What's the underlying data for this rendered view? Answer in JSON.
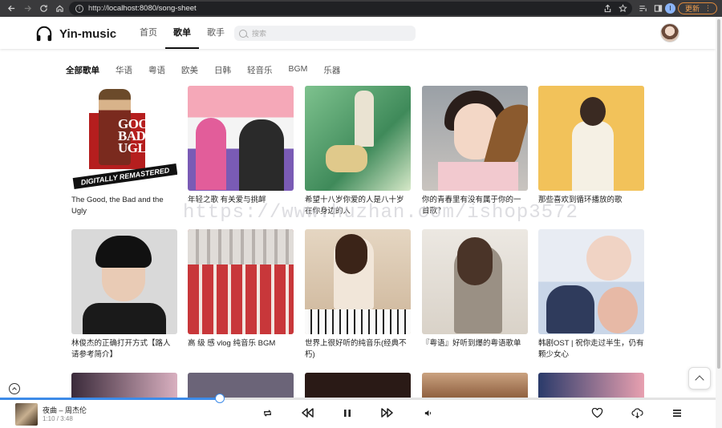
{
  "browser": {
    "url_scheme": "http://",
    "url_rest": "localhost:8080/song-sheet",
    "profile_initial": "I",
    "update_label": "更新"
  },
  "app": {
    "logo_text": "Yin-music",
    "nav": [
      {
        "label": "首页",
        "active": false
      },
      {
        "label": "歌单",
        "active": true
      },
      {
        "label": "歌手",
        "active": false
      }
    ],
    "search_placeholder": "搜索"
  },
  "categories": [
    {
      "label": "全部歌单",
      "active": true
    },
    {
      "label": "华语",
      "active": false
    },
    {
      "label": "粤语",
      "active": false
    },
    {
      "label": "欧美",
      "active": false
    },
    {
      "label": "日韩",
      "active": false
    },
    {
      "label": "轻音乐",
      "active": false
    },
    {
      "label": "BGM",
      "active": false
    },
    {
      "label": "乐器",
      "active": false
    }
  ],
  "playlists": [
    {
      "title": "The Good, the Bad and the Ugly",
      "cover_text_1": "GOOD",
      "cover_text_2": "BAD",
      "cover_text_3": "UGLY",
      "cover_banner": "DIGITALLY REMASTERED"
    },
    {
      "title": "年轻之歌 有关爱与挑衅"
    },
    {
      "title": "希望十八岁你爱的人是八十岁在你身边的人"
    },
    {
      "title": "你的青春里有没有属于你的一首歌？"
    },
    {
      "title": "那些喜欢到循环播放的歌"
    },
    {
      "title": "林俊杰的正确打开方式【路人请参考简介】"
    },
    {
      "title": "高 级 感 vlog 纯音乐 BGM"
    },
    {
      "title": "世界上很好听的纯音乐(经典不朽)"
    },
    {
      "title": "『粤语』好听到爆的粤语歌单"
    },
    {
      "title": "韩剧OST | 祝你走过半生，仍有颗少女心"
    }
  ],
  "watermark": "https://www.huzhan.com/ishop3572",
  "player": {
    "now_playing": "夜曲 – 周杰伦",
    "time": "1:10 / 3:48",
    "progress": 0.307
  },
  "colors": {
    "accent": "#3d8be8",
    "update_orange": "#f0a050",
    "chrome_bg": "#3a3a3c"
  },
  "icons": [
    "back-icon",
    "forward-icon",
    "reload-icon",
    "home-icon",
    "info-icon",
    "share-icon",
    "star-icon",
    "playlist-icon",
    "sidebar-icon",
    "kebab-icon",
    "headphones-logo-icon",
    "search-icon",
    "chevron-up-icon",
    "loop-icon",
    "previous-icon",
    "pause-icon",
    "next-icon",
    "volume-icon",
    "heart-icon",
    "download-icon",
    "menu-icon"
  ]
}
